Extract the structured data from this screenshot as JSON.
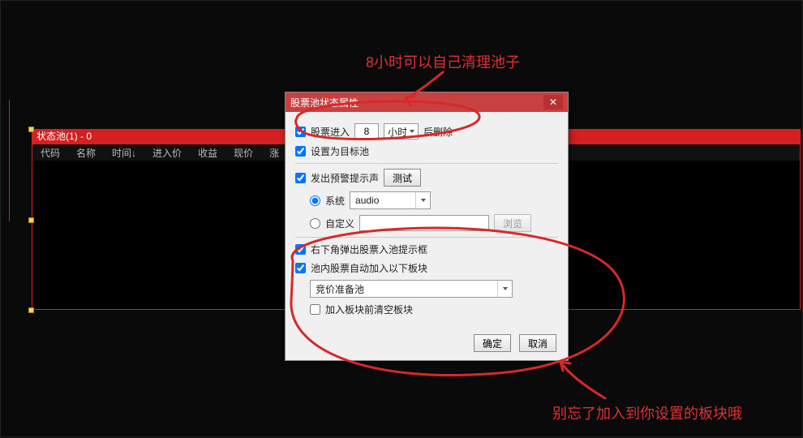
{
  "annotations": {
    "top": "8小时可以自己清理池子",
    "bottom": "别忘了加入到你设置的板块哦"
  },
  "background": {
    "panel_title": "状态池(1) - 0",
    "columns": [
      "代码",
      "名称",
      "时间↓",
      "进入价",
      "收益",
      "现价",
      "涨"
    ]
  },
  "dialog": {
    "title": "股票池状态属性",
    "close": "✕",
    "row_delete_prefix": "股票进入",
    "row_delete_value": "8",
    "row_delete_unit": "小时",
    "row_delete_suffix": "后删除",
    "set_target": "设置为目标池",
    "alert_sound": "发出预警提示声",
    "test_btn": "测试",
    "system_label": "系统",
    "audio_value": "audio",
    "custom_label": "自定义",
    "custom_placeholder": "",
    "browse_btn": "浏览",
    "popup_label": "右下角弹出股票入池提示框",
    "auto_add_label": "池内股票自动加入以下板块",
    "plate_value": "竞价准备池",
    "clear_plate_label": "加入板块前清空板块",
    "ok_btn": "确定",
    "cancel_btn": "取消"
  }
}
